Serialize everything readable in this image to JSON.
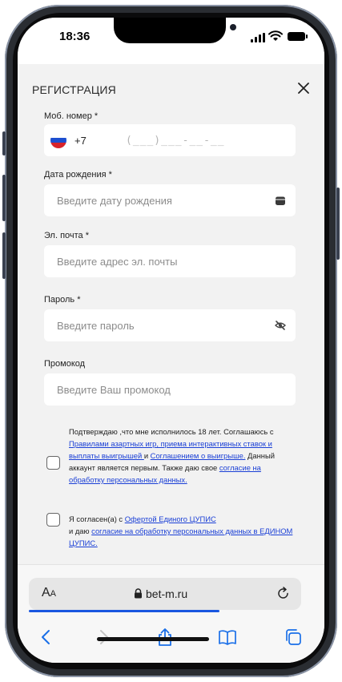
{
  "status": {
    "time": "18:36"
  },
  "header": {
    "title": "РЕГИСТРАЦИЯ"
  },
  "form": {
    "phone_label": "Моб. номер *",
    "phone_code": "+7",
    "phone_mask": "(___)___-__-__",
    "birth_label": "Дата рождения *",
    "birth_placeholder": "Введите дату рождения",
    "email_label": "Эл. почта *",
    "email_placeholder": "Введите адрес эл. почты",
    "password_label": "Пароль *",
    "password_placeholder": "Введите пароль",
    "promo_label": "Промокод",
    "promo_placeholder": "Введите Ваш промокод"
  },
  "consent1": {
    "t1": "Подтверждаю ,что мне исполнилось 18 лет. Соглашаюсь с ",
    "l1": "Правилами азартных игр, приема интерактивных ставок и выплаты выигрышей ",
    "t2": "и ",
    "l2": "Соглашением о выигрыше.",
    "t3": " Данный аккаунт является первым. Также даю свое ",
    "l3": "согласие на обработку персональных данных."
  },
  "consent2": {
    "t1": "Я согласен(а) с ",
    "l1": "Офертой Единого ЦУПИС",
    "t2": " и даю ",
    "l2": "согласие на обработку персональных данных в ЕДИНОМ ЦУПИС."
  },
  "browser": {
    "aa_big": "A",
    "aa_small": "A",
    "url": "bet-m.ru",
    "load_progress": 0.7
  },
  "colors": {
    "accent": "#1532d2",
    "link": "#1a3fd6",
    "progress": "#1a57e0"
  },
  "icons": [
    "close-icon",
    "flag-ru-icon",
    "calendar-icon",
    "eye-off-icon",
    "lock-icon",
    "reload-icon",
    "back-icon",
    "forward-icon",
    "share-icon",
    "bookmarks-icon",
    "tabs-icon"
  ]
}
